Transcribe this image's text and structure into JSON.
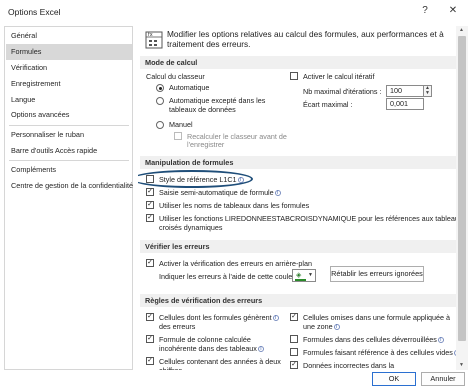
{
  "window": {
    "title": "Options Excel",
    "help_icon": "?",
    "close_icon": "✕"
  },
  "sidebar": {
    "items": [
      {
        "label": "Général"
      },
      {
        "label": "Formules"
      },
      {
        "label": "Vérification"
      },
      {
        "label": "Enregistrement"
      },
      {
        "label": "Langue"
      },
      {
        "label": "Options avancées"
      },
      {
        "label": "Personnaliser le ruban"
      },
      {
        "label": "Barre d'outils Accès rapide"
      },
      {
        "label": "Compléments"
      },
      {
        "label": "Centre de gestion de la confidentialité"
      }
    ]
  },
  "header": {
    "line1": "Modifier les options relatives au calcul des formules, aux performances et à",
    "line2": "traitement des erreurs."
  },
  "calc": {
    "section": "Mode de calcul",
    "workbook_label": "Calcul du classeur",
    "radio_auto": "Automatique",
    "radio_auto_except_1": "Automatique excepté dans les",
    "radio_auto_except_2": "tableaux de données",
    "radio_manual": "Manuel",
    "recalc_1": "Recalculer le classeur avant de",
    "recalc_2": "l'enregistrer",
    "iterative": "Activer le calcul itératif",
    "max_iter_label": "Nb maximal d'itérations :",
    "max_iter_value": "100",
    "max_change_label": "Écart maximal :",
    "max_change_value": "0,001"
  },
  "formulas": {
    "section": "Manipulation de formules",
    "r1c1": "Style de référence L1C1",
    "autocomplete": "Saisie semi-automatique de formule",
    "table_names": "Utiliser les noms de tableaux dans les formules",
    "getpivot_1": "Utiliser les fonctions LIREDONNEESTABCROISDYNAMIQUE pour les références aux tableaux",
    "getpivot_2": "croisés dynamiques"
  },
  "errors": {
    "section": "Vérifier les erreurs",
    "background": "Activer la vérification des erreurs en arrière-plan",
    "color_label": "Indiquer les erreurs à l'aide de cette couleur :",
    "reset_button": "Rétablir les erreurs ignorées"
  },
  "rules": {
    "section": "Règles de vérification des erreurs",
    "left": [
      {
        "l1": "Cellules dont les formules génèrent",
        "l2": "des erreurs",
        "checked": true
      },
      {
        "l1": "Formule de colonne calculée",
        "l2": "incohérente dans des tableaux",
        "checked": true
      },
      {
        "l1": "Cellules contenant des années à deux",
        "l2": "chiffres",
        "checked": true
      }
    ],
    "right": [
      {
        "l1": "Cellules omises dans une formule appliquée à",
        "l2": "une zone",
        "checked": true
      },
      {
        "l1": "Formules dans des cellules déverrouillées",
        "l2": "",
        "checked": false
      },
      {
        "l1": "Formules faisant référence à des cellules vides",
        "l2": "",
        "checked": false
      },
      {
        "l1": "Données incorrectes dans la",
        "l2": "",
        "checked": true
      }
    ]
  },
  "footer": {
    "ok": "OK",
    "cancel": "Annuler"
  },
  "colors": {
    "highlight_circle": "#1f4e79",
    "section_bg": "#f0f0f0",
    "sidebar_active": "#d8d8d8"
  }
}
